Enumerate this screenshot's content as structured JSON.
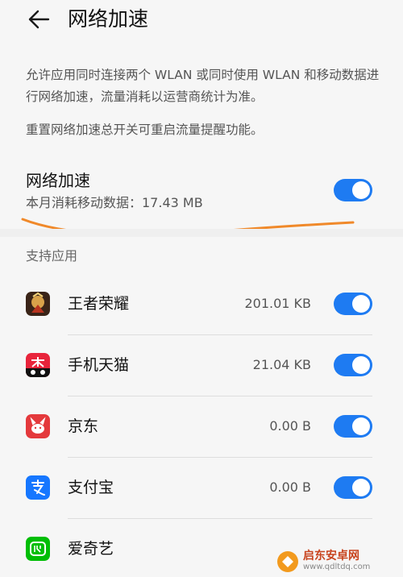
{
  "header": {
    "title": "网络加速",
    "back_icon": "arrow-left-icon"
  },
  "description": {
    "line1": "允许应用同时连接两个 WLAN 或同时使用 WLAN 和移动数据进行网络加速，流量消耗以运营商统计为准。",
    "line2": "重置网络加速总开关可重启流量提醒功能。"
  },
  "main_toggle": {
    "title": "网络加速",
    "subtitle": "本月消耗移动数据：17.43 MB",
    "enabled": true
  },
  "section": {
    "label": "支持应用"
  },
  "apps": [
    {
      "name": "王者荣耀",
      "usage": "201.01 KB",
      "enabled": true,
      "icon": "honor-of-kings-icon"
    },
    {
      "name": "手机天猫",
      "usage": "21.04 KB",
      "enabled": true,
      "icon": "tmall-icon"
    },
    {
      "name": "京东",
      "usage": "0.00 B",
      "enabled": true,
      "icon": "jd-icon"
    },
    {
      "name": "支付宝",
      "usage": "0.00 B",
      "enabled": true,
      "icon": "alipay-icon"
    },
    {
      "name": "爱奇艺",
      "usage": "",
      "enabled": false,
      "icon": "iqiyi-icon"
    }
  ],
  "watermark": {
    "text": "启东安卓网",
    "url_text": "www.qdltdq.com"
  },
  "colors": {
    "accent": "#1e7bf2",
    "annotation": "#f0892a",
    "jd": "#e4393c",
    "alipay": "#1677ff",
    "iqiyi": "#00be06"
  }
}
